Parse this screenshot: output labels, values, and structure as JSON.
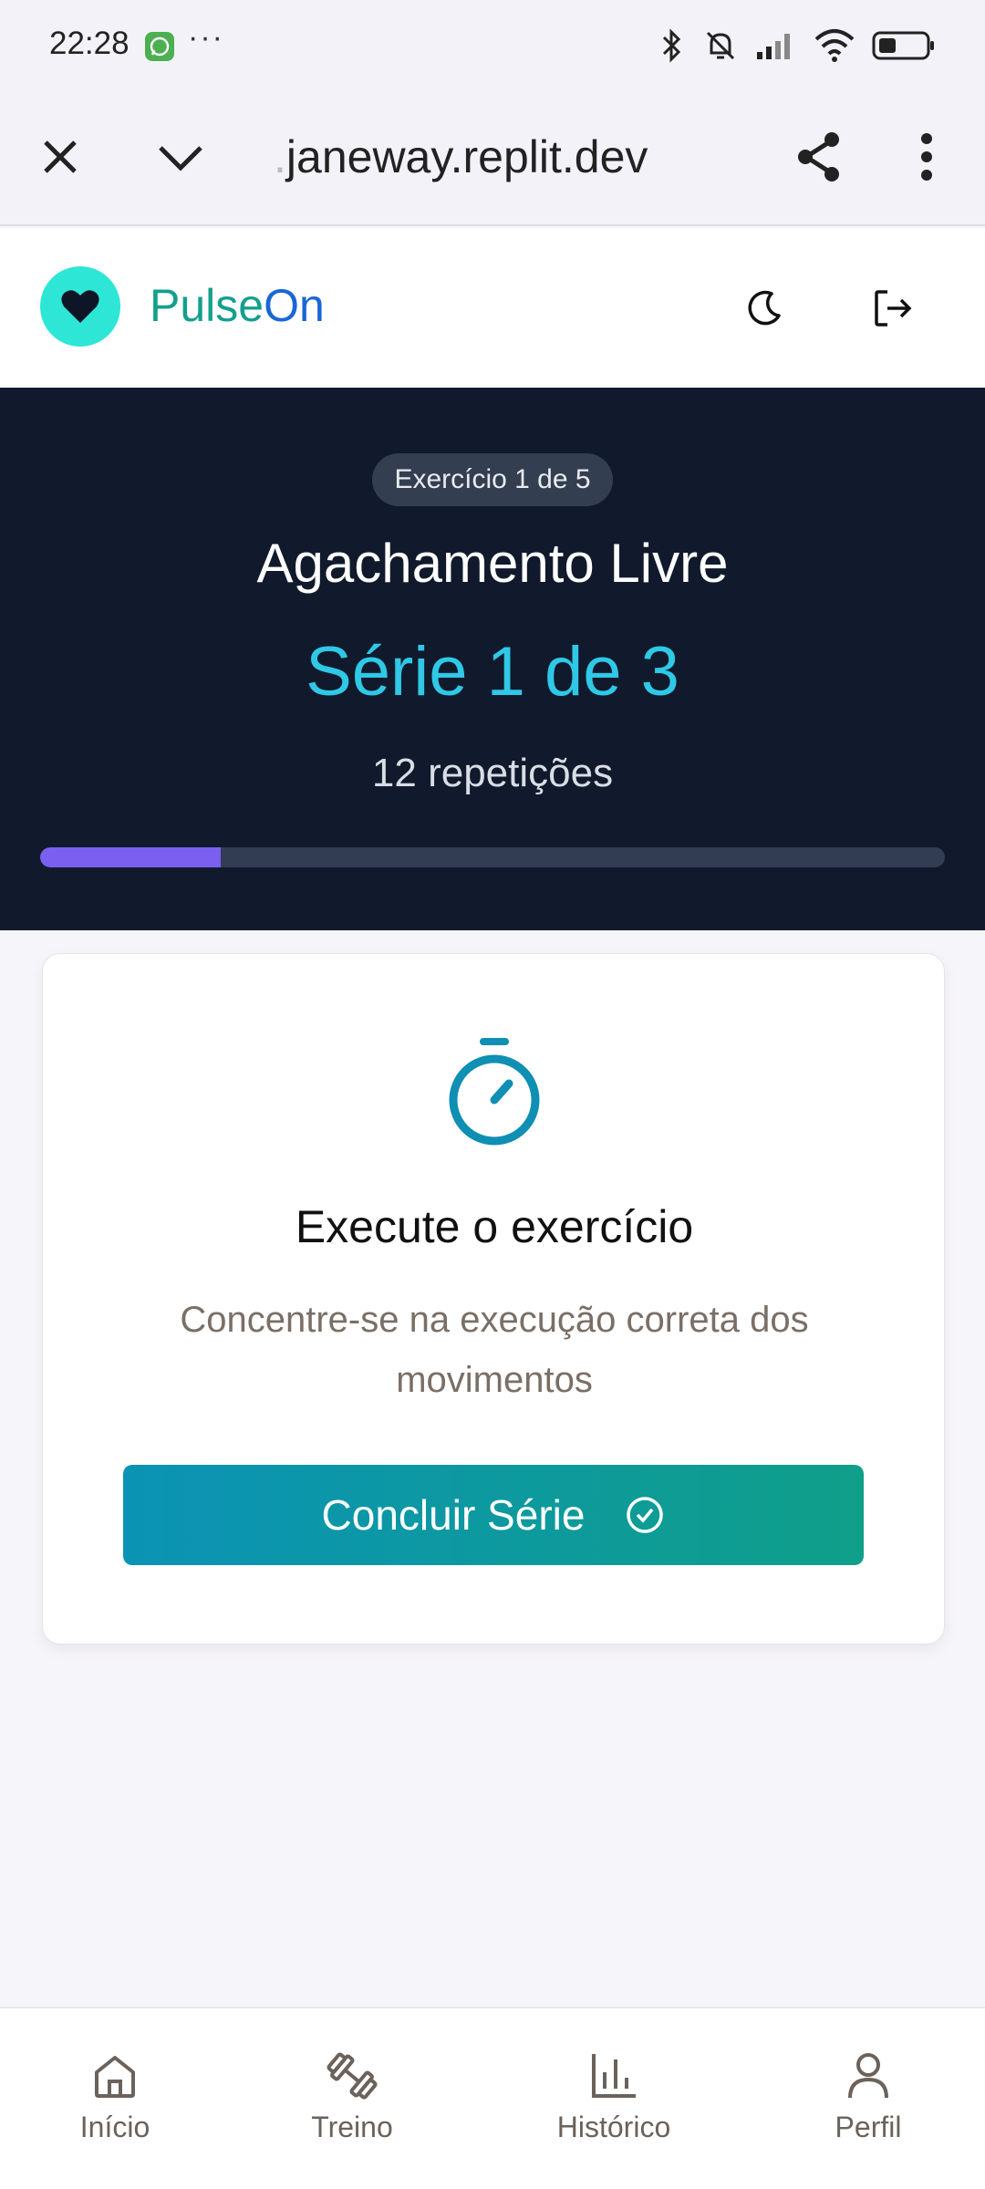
{
  "status_bar": {
    "time": "22:28",
    "more": "···",
    "icons": [
      "whatsapp-icon",
      "bluetooth-icon",
      "mute-icon",
      "signal-icon",
      "wifi-icon",
      "battery-icon"
    ]
  },
  "browser": {
    "url_prefix": ".",
    "url": "janeway.replit.dev",
    "icons": [
      "close-icon",
      "chevron-down-icon",
      "share-icon",
      "more-vertical-icon"
    ]
  },
  "header": {
    "brand_part1": "Pulse",
    "brand_part2": "On",
    "icons": [
      "heart-icon",
      "moon-icon",
      "logout-icon"
    ]
  },
  "workout": {
    "badge": "Exercício 1 de 5",
    "exercise_name": "Agachamento Livre",
    "series_text": "Série 1 de 3",
    "reps_text": "12 repetições",
    "progress_fraction": 0.2
  },
  "card": {
    "title": "Execute o exercício",
    "subtitle": "Concentre-se na execução correta dos movimentos",
    "button_label": "Concluir Série"
  },
  "nav": {
    "items": [
      {
        "label": "Início",
        "icon": "home-icon"
      },
      {
        "label": "Treino",
        "icon": "dumbbell-icon"
      },
      {
        "label": "Histórico",
        "icon": "bar-chart-icon"
      },
      {
        "label": "Perfil",
        "icon": "user-icon"
      }
    ]
  },
  "colors": {
    "hero_bg": "#111a2c",
    "accent_cyan": "#2fc8e6",
    "progress": "#7a5ff0",
    "cta_start": "#0b93b5",
    "cta_end": "#0f9f89"
  }
}
